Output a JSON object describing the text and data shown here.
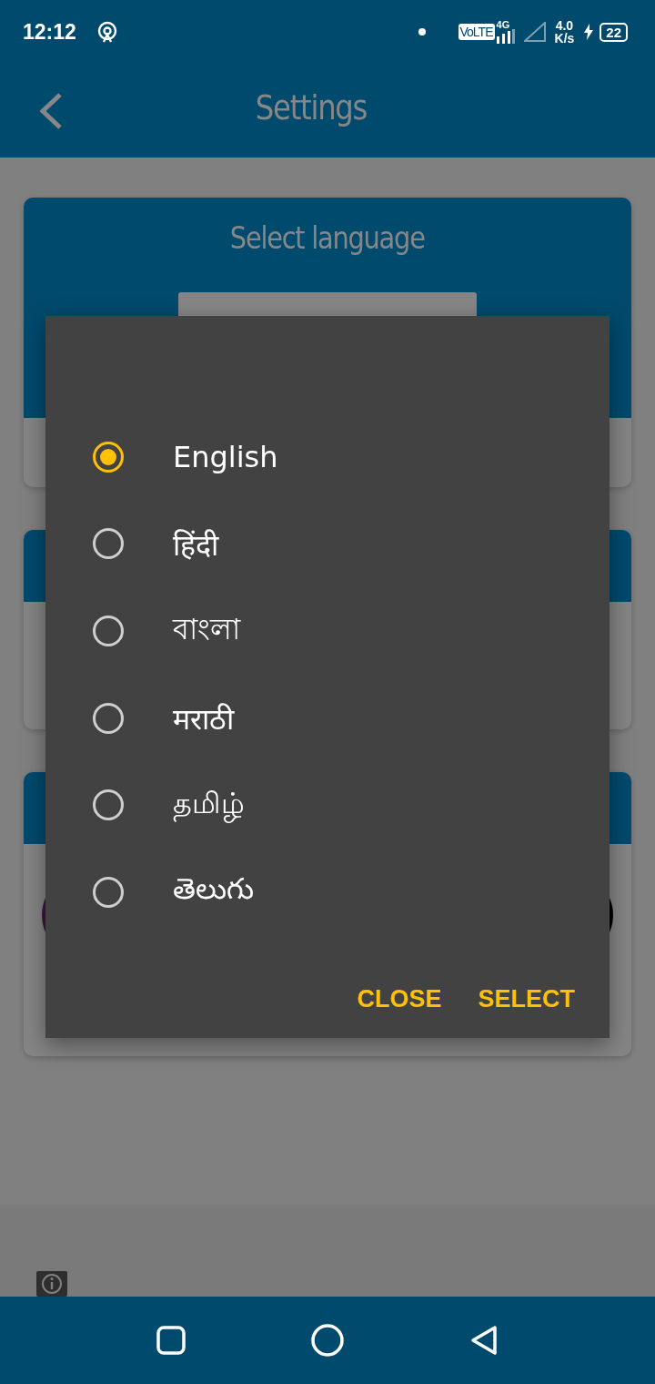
{
  "status_bar": {
    "time": "12:12",
    "volte": "VoLTE",
    "network": "4G",
    "speed_value": "4.0",
    "speed_unit": "K/s",
    "battery": "22"
  },
  "app_bar": {
    "title": "Settings"
  },
  "language_card": {
    "title": "Select language"
  },
  "language_dialog": {
    "options": [
      {
        "label": "English",
        "selected": true
      },
      {
        "label": "हिंदी",
        "selected": false
      },
      {
        "label": "বাংলা",
        "selected": false
      },
      {
        "label": "मराठी",
        "selected": false
      },
      {
        "label": "தமிழ்",
        "selected": false
      },
      {
        "label": "తెలుగు",
        "selected": false
      }
    ],
    "buttons": [
      "CLOSE",
      "SELECT"
    ]
  }
}
